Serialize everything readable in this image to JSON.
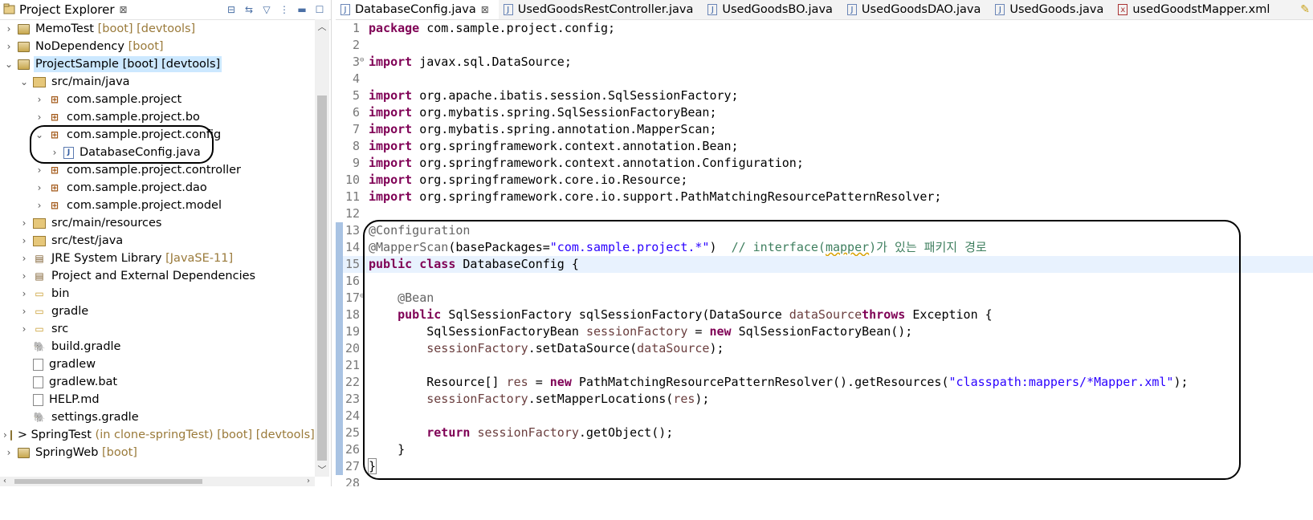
{
  "explorer": {
    "title": "Project Explorer",
    "tree": [
      {
        "depth": 0,
        "twisty": "collapsed",
        "icon": "project-icon",
        "label": "MemoTest",
        "deco": "[boot] [devtools]"
      },
      {
        "depth": 0,
        "twisty": "collapsed",
        "icon": "project-icon",
        "label": "NoDependency",
        "deco": "[boot]"
      },
      {
        "depth": 0,
        "twisty": "expanded",
        "icon": "project-icon",
        "label": "ProjectSample [boot] [devtools]",
        "deco": "",
        "selected": true
      },
      {
        "depth": 1,
        "twisty": "expanded",
        "icon": "source-folder-icon",
        "label": "src/main/java",
        "deco": ""
      },
      {
        "depth": 2,
        "twisty": "collapsed",
        "icon": "package-icon",
        "label": "com.sample.project",
        "deco": ""
      },
      {
        "depth": 2,
        "twisty": "collapsed",
        "icon": "package-icon",
        "label": "com.sample.project.bo",
        "deco": ""
      },
      {
        "depth": 2,
        "twisty": "expanded",
        "icon": "package-icon",
        "label": "com.sample.project.config",
        "deco": ""
      },
      {
        "depth": 3,
        "twisty": "collapsed",
        "icon": "java-file-icon",
        "label": "DatabaseConfig.java",
        "deco": ""
      },
      {
        "depth": 2,
        "twisty": "collapsed",
        "icon": "package-icon",
        "label": "com.sample.project.controller",
        "deco": ""
      },
      {
        "depth": 2,
        "twisty": "collapsed",
        "icon": "package-icon",
        "label": "com.sample.project.dao",
        "deco": ""
      },
      {
        "depth": 2,
        "twisty": "collapsed",
        "icon": "package-icon",
        "label": "com.sample.project.model",
        "deco": ""
      },
      {
        "depth": 1,
        "twisty": "collapsed",
        "icon": "source-folder-icon",
        "label": "src/main/resources",
        "deco": ""
      },
      {
        "depth": 1,
        "twisty": "collapsed",
        "icon": "source-folder-icon",
        "label": "src/test/java",
        "deco": ""
      },
      {
        "depth": 1,
        "twisty": "collapsed",
        "icon": "library-icon",
        "label": "JRE System Library",
        "deco": "[JavaSE-11]"
      },
      {
        "depth": 1,
        "twisty": "collapsed",
        "icon": "library-icon",
        "label": "Project and External Dependencies",
        "deco": ""
      },
      {
        "depth": 1,
        "twisty": "collapsed",
        "icon": "folder-icon",
        "label": "bin",
        "deco": ""
      },
      {
        "depth": 1,
        "twisty": "collapsed",
        "icon": "folder-icon",
        "label": "gradle",
        "deco": ""
      },
      {
        "depth": 1,
        "twisty": "collapsed",
        "icon": "folder-icon",
        "label": "src",
        "deco": ""
      },
      {
        "depth": 1,
        "twisty": "none",
        "icon": "gradle-icon",
        "label": "build.gradle",
        "deco": ""
      },
      {
        "depth": 1,
        "twisty": "none",
        "icon": "file-icon",
        "label": "gradlew",
        "deco": ""
      },
      {
        "depth": 1,
        "twisty": "none",
        "icon": "file-icon",
        "label": "gradlew.bat",
        "deco": ""
      },
      {
        "depth": 1,
        "twisty": "none",
        "icon": "markdown-file-icon",
        "label": "HELP.md",
        "deco": ""
      },
      {
        "depth": 1,
        "twisty": "none",
        "icon": "gradle-icon",
        "label": "settings.gradle",
        "deco": ""
      },
      {
        "depth": 0,
        "twisty": "collapsed",
        "icon": "project-error-icon",
        "label": "> SpringTest",
        "deco": "(in clone-springTest) [boot] [devtools] [c"
      },
      {
        "depth": 0,
        "twisty": "collapsed",
        "icon": "project-icon",
        "label": "SpringWeb",
        "deco": "[boot]"
      }
    ]
  },
  "editor": {
    "tabs": [
      {
        "label": "DatabaseConfig.java",
        "active": true,
        "closable": true,
        "type": "java"
      },
      {
        "label": "UsedGoodsRestController.java",
        "active": false,
        "closable": false,
        "type": "java"
      },
      {
        "label": "UsedGoodsBO.java",
        "active": false,
        "closable": false,
        "type": "java"
      },
      {
        "label": "UsedGoodsDAO.java",
        "active": false,
        "closable": false,
        "type": "java"
      },
      {
        "label": "UsedGoods.java",
        "active": false,
        "closable": false,
        "type": "java"
      },
      {
        "label": "usedGoodstMapper.xml",
        "active": false,
        "closable": false,
        "type": "xml"
      }
    ],
    "current_line": 15,
    "lines": [
      {
        "n": "1",
        "segs": [
          [
            "kw",
            "package"
          ],
          [
            "",
            "com.sample.project.config;"
          ]
        ]
      },
      {
        "n": "2",
        "segs": []
      },
      {
        "n": "3",
        "fold": true,
        "segs": [
          [
            "kw",
            "import"
          ],
          [
            "",
            " javax.sql.DataSource;"
          ]
        ]
      },
      {
        "n": "4",
        "segs": []
      },
      {
        "n": "5",
        "segs": [
          [
            "kw",
            "import"
          ],
          [
            "",
            " org.apache.ibatis.session.SqlSessionFactory;"
          ]
        ]
      },
      {
        "n": "6",
        "segs": [
          [
            "kw",
            "import"
          ],
          [
            "",
            " org.mybatis.spring.SqlSessionFactoryBean;"
          ]
        ]
      },
      {
        "n": "7",
        "segs": [
          [
            "kw",
            "import"
          ],
          [
            "",
            " org.mybatis.spring.annotation.MapperScan;"
          ]
        ]
      },
      {
        "n": "8",
        "segs": [
          [
            "kw",
            "import"
          ],
          [
            "",
            " org.springframework.context.annotation.Bean;"
          ]
        ]
      },
      {
        "n": "9",
        "segs": [
          [
            "kw",
            "import"
          ],
          [
            "",
            " org.springframework.context.annotation.Configuration;"
          ]
        ]
      },
      {
        "n": "10",
        "segs": [
          [
            "kw",
            "import"
          ],
          [
            "",
            " org.springframework.core.io.Resource;"
          ]
        ]
      },
      {
        "n": "11",
        "segs": [
          [
            "kw",
            "import"
          ],
          [
            "",
            " org.springframework.core.io.support.PathMatchingResourcePatternResolver;"
          ]
        ]
      },
      {
        "n": "12",
        "segs": []
      },
      {
        "n": "13",
        "mark": true,
        "segs": [
          [
            "ann",
            "@Configuration"
          ]
        ]
      },
      {
        "n": "14",
        "mark": true,
        "segs": [
          [
            "ann",
            "@MapperScan"
          ],
          [
            "",
            "(basePackages="
          ],
          [
            "str",
            "\"com.sample.project.*\""
          ],
          [
            "",
            ")  "
          ],
          [
            "cmt",
            "// interface("
          ],
          [
            "cmt spell",
            "mapper"
          ],
          [
            "cmt",
            ")가 있는 패키지 경로"
          ]
        ]
      },
      {
        "n": "15",
        "mark": true,
        "segs": [
          [
            "kw",
            "public class"
          ],
          [
            "",
            " DatabaseConfig {"
          ]
        ]
      },
      {
        "n": "16",
        "mark": true,
        "segs": []
      },
      {
        "n": "17",
        "mark": true,
        "fold": true,
        "segs": [
          [
            "",
            "    "
          ],
          [
            "ann",
            "@Bean"
          ]
        ]
      },
      {
        "n": "18",
        "mark": true,
        "segs": [
          [
            "",
            "    "
          ],
          [
            "kw",
            "public"
          ],
          [
            "",
            " SqlSessionFactory sqlSessionFactory(DataSource "
          ],
          [
            "fld",
            "dataSource"
          ],
          [
            ") "
          ],
          [
            "kw",
            "throws"
          ],
          [
            "",
            " Exception {"
          ]
        ]
      },
      {
        "n": "19",
        "mark": true,
        "segs": [
          [
            "",
            "        SqlSessionFactoryBean "
          ],
          [
            "fld",
            "sessionFactory"
          ],
          [
            "",
            " = "
          ],
          [
            "kw",
            "new"
          ],
          [
            "",
            " SqlSessionFactoryBean();"
          ]
        ]
      },
      {
        "n": "20",
        "mark": true,
        "segs": [
          [
            "",
            "        "
          ],
          [
            "fld",
            "sessionFactory"
          ],
          [
            "",
            ".setDataSource("
          ],
          [
            "fld",
            "dataSource"
          ],
          [
            "",
            ");"
          ]
        ]
      },
      {
        "n": "21",
        "mark": true,
        "segs": []
      },
      {
        "n": "22",
        "mark": true,
        "segs": [
          [
            "",
            "        Resource[] "
          ],
          [
            "fld",
            "res"
          ],
          [
            "",
            " = "
          ],
          [
            "kw",
            "new"
          ],
          [
            "",
            " PathMatchingResourcePatternResolver().getResources("
          ],
          [
            "str",
            "\"classpath:mappers/*Mapper.xml\""
          ],
          [
            "",
            ");"
          ]
        ]
      },
      {
        "n": "23",
        "mark": true,
        "segs": [
          [
            "",
            "        "
          ],
          [
            "fld",
            "sessionFactory"
          ],
          [
            "",
            ".setMapperLocations("
          ],
          [
            "fld",
            "res"
          ],
          [
            "",
            ");"
          ]
        ]
      },
      {
        "n": "24",
        "mark": true,
        "segs": []
      },
      {
        "n": "25",
        "mark": true,
        "segs": [
          [
            "",
            "        "
          ],
          [
            "kw",
            "return"
          ],
          [
            "",
            " "
          ],
          [
            "fld",
            "sessionFactory"
          ],
          [
            "",
            ".getObject();"
          ]
        ]
      },
      {
        "n": "26",
        "mark": true,
        "segs": [
          [
            "",
            "    }"
          ]
        ]
      },
      {
        "n": "27",
        "mark": true,
        "segs": [
          [
            "brace",
            "}"
          ]
        ]
      },
      {
        "n": "28",
        "segs": []
      }
    ]
  }
}
